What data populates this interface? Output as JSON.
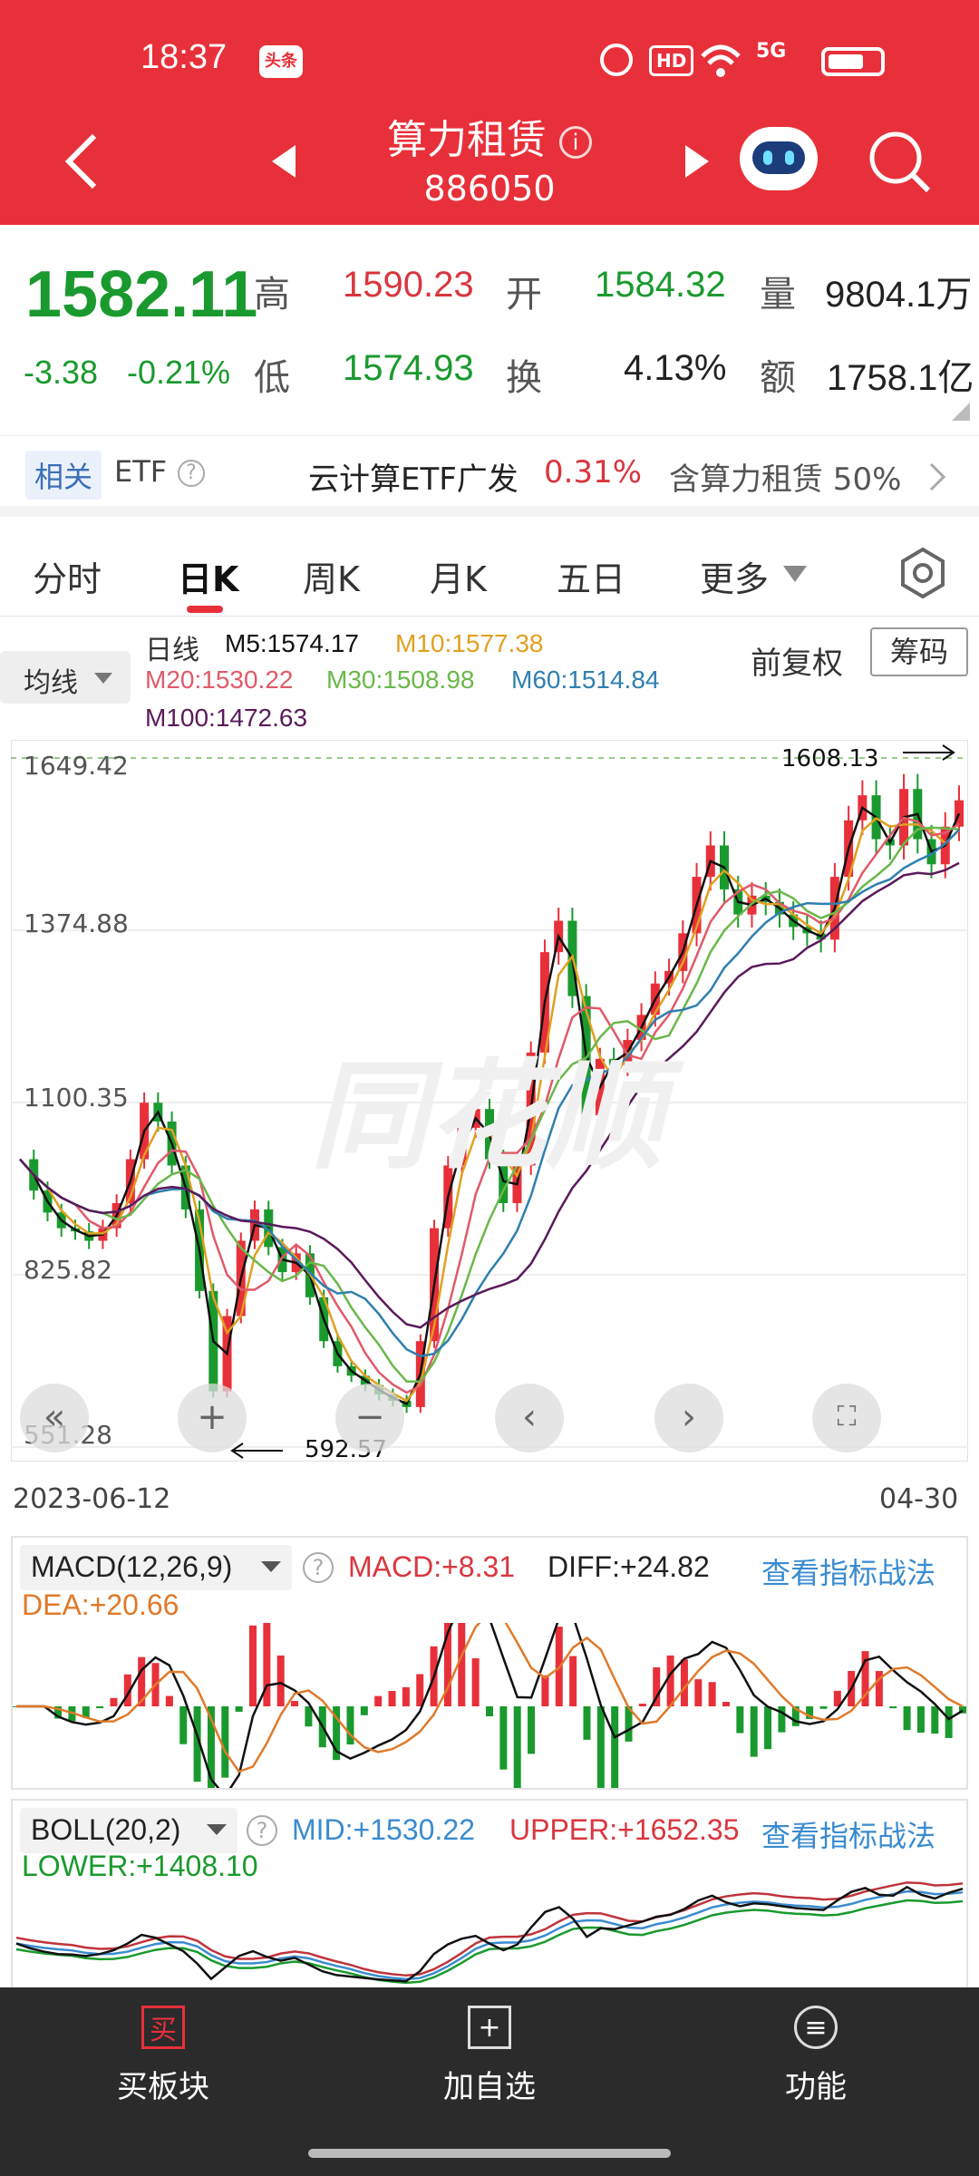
{
  "status_bar": {
    "time": "18:37",
    "app_badge": "头条",
    "hd": "HD",
    "network": "5G"
  },
  "header": {
    "title": "算力租赁",
    "code": "886050"
  },
  "quote": {
    "price": "1582.11",
    "change": "-3.38",
    "change_pct": "-0.21%",
    "high_label": "高",
    "high": "1590.23",
    "low_label": "低",
    "low": "1574.93",
    "open_label": "开",
    "open": "1584.32",
    "turnover_label": "换",
    "turnover": "4.13%",
    "volume_label": "量",
    "volume": "9804.1万",
    "amount_label": "额",
    "amount": "1758.1亿"
  },
  "etf": {
    "tag": "相关",
    "label": "ETF",
    "name": "云计算ETF广发",
    "pct": "0.31%",
    "holding": "含算力租赁 50%"
  },
  "tabs": [
    "分时",
    "日K",
    "周K",
    "月K",
    "五日",
    "更多"
  ],
  "active_tab": "日K",
  "chart_toolbar": {
    "ma_select": "均线",
    "line_label": "日线",
    "adjust": "前复权",
    "chips": "筹码"
  },
  "ma_values": {
    "m5": "M5:1574.17",
    "m10": "M10:1577.38",
    "m20": "M20:1530.22",
    "m30": "M30:1508.98",
    "m60": "M60:1514.84",
    "m100": "M100:1472.63"
  },
  "colors": {
    "m5": "#111111",
    "m10": "#e0a020",
    "m20": "#e05a6a",
    "m30": "#6ab84a",
    "m60": "#2f7fb0",
    "m100": "#5a1a5a",
    "up": "#e8303a",
    "down": "#1a9a2e"
  },
  "chart_data": {
    "type": "line",
    "title": "",
    "xlabel": "",
    "ylabel": "",
    "ylim": [
      551.28,
      1649.42
    ],
    "y_ticks": [
      "1649.42",
      "1374.88",
      "1100.35",
      "825.82",
      "551.28"
    ],
    "x_start": "2023-06-12",
    "x_end": "04-30",
    "max_label": "1608.13",
    "min_label": "592.57",
    "series": [
      {
        "name": "日线",
        "values": [
          1010,
          960,
          925,
          900,
          895,
          880,
          900,
          940,
          1010,
          1100,
          1070,
          1000,
          930,
          800,
          640,
          760,
          880,
          930,
          870,
          830,
          860,
          790,
          720,
          680,
          665,
          650,
          635,
          625,
          615,
          720,
          900,
          1000,
          1060,
          1090,
          1010,
          940,
          1000,
          1180,
          1340,
          1390,
          1270,
          1080,
          1170,
          1160,
          1200,
          1240,
          1290,
          1310,
          1370,
          1460,
          1510,
          1440,
          1400,
          1430,
          1420,
          1400,
          1380,
          1370,
          1360,
          1460,
          1550,
          1590,
          1520,
          1510,
          1600,
          1520,
          1480,
          1540,
          1582
        ]
      }
    ]
  },
  "macd": {
    "title": "MACD(12,26,9)",
    "macd": "MACD:+8.31",
    "diff": "DIFF:+24.82",
    "dea": "DEA:+20.66",
    "link": "查看指标战法"
  },
  "boll": {
    "title": "BOLL(20,2)",
    "mid": "MID:+1530.22",
    "upper": "UPPER:+1652.35",
    "lower": "LOWER:+1408.10",
    "link": "查看指标战法"
  },
  "bottom_bar": {
    "buy": "买板块",
    "buy_icon": "买",
    "add": "加自选",
    "func": "功能"
  }
}
